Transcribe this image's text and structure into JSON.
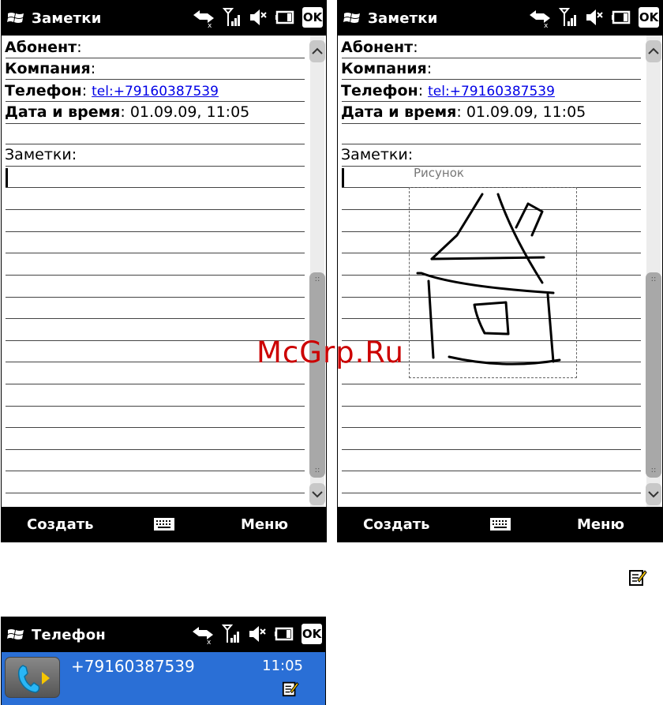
{
  "screen1": {
    "title": "Заметки",
    "ok_label": "OK",
    "fields": [
      {
        "label": "Абонент",
        "sep": ":",
        "value": ""
      },
      {
        "label": "Компания",
        "sep": ":",
        "value": ""
      },
      {
        "label": "Телефон",
        "sep": ":",
        "value": "tel:+79160387539"
      },
      {
        "label": "Дата и время",
        "sep": ":",
        "value": "01.09.09, 11:05"
      }
    ],
    "notes_label": "Заметки:",
    "softkeys": {
      "left": "Создать",
      "right": "Меню"
    }
  },
  "screen2": {
    "title": "Заметки",
    "ok_label": "OK",
    "fields": [
      {
        "label": "Абонент",
        "sep": ":",
        "value": ""
      },
      {
        "label": "Компания",
        "sep": ":",
        "value": ""
      },
      {
        "label": "Телефон",
        "sep": ":",
        "value": "tel:+79160387539"
      },
      {
        "label": "Дата и время",
        "sep": ":",
        "value": "01.09.09, 11:05"
      }
    ],
    "notes_label": "Заметки:",
    "drawing_caption": "Рисунок",
    "softkeys": {
      "left": "Создать",
      "right": "Меню"
    }
  },
  "screen3": {
    "title": "Телефон",
    "ok_label": "OK",
    "phone_number": "+79160387539",
    "call_time": "11:05"
  },
  "watermark": "McGrp.Ru",
  "colors": {
    "link": "#0000e6",
    "call_bg": "#2a6fd6",
    "watermark": "#cc0000"
  }
}
